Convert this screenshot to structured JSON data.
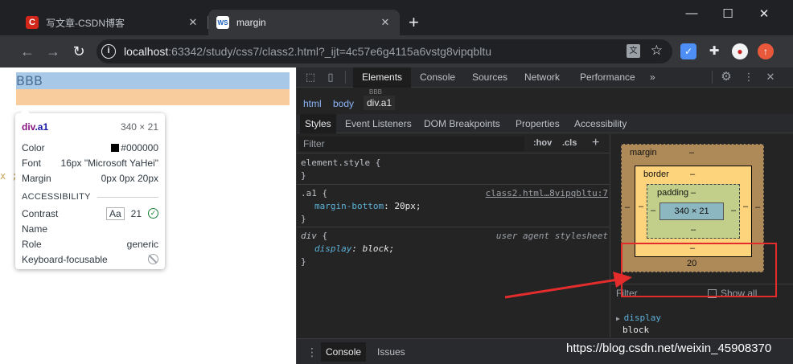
{
  "browser": {
    "tabs": [
      {
        "title": "写文章-CSDN博客",
        "favicon": "C",
        "active": false
      },
      {
        "title": "margin",
        "favicon": "WS",
        "active": true
      }
    ],
    "url_host": "localhost",
    "url_path": ":63342/study/css7/class2.html?_ijt=4c57e6g4115a6vstg8vipqbltu"
  },
  "page": {
    "element_text": "BBB",
    "gutter_text": "x ;"
  },
  "tooltip": {
    "tag": "div",
    "cls": ".a1",
    "size": "340 × 21",
    "rows": [
      {
        "label": "Color",
        "value": "#000000"
      },
      {
        "label": "Font",
        "value": "16px \"Microsoft YaHei\""
      },
      {
        "label": "Margin",
        "value": "0px 0px 20px"
      }
    ],
    "section": "ACCESSIBILITY",
    "acc": [
      {
        "label": "Contrast",
        "aa": "Aa",
        "value": "21"
      },
      {
        "label": "Name",
        "value": ""
      },
      {
        "label": "Role",
        "value": "generic"
      },
      {
        "label": "Keyboard-focusable",
        "value": ""
      }
    ]
  },
  "devtools": {
    "tabs": [
      "Elements",
      "Console",
      "Sources",
      "Network",
      "Performance",
      "»"
    ],
    "breadcrumb_faded": "BBB",
    "breadcrumbs": [
      "html",
      "body",
      "div.a1"
    ],
    "sub_tabs": [
      "Styles",
      "Event Listeners",
      "DOM Breakpoints",
      "Properties",
      "Accessibility"
    ],
    "filter_placeholder": "Filter",
    "hov": ":hov",
    "cls": ".cls",
    "plus": "+",
    "rules": {
      "element": {
        "selector": "element.style {",
        "close": "}"
      },
      "a1": {
        "selector": ".a1",
        "open": " {",
        "source": "class2.html…8vipqbltu:7",
        "prop": "margin-bottom",
        "value": "20px;",
        "close": "}"
      },
      "div": {
        "selector": "div",
        "open": " {",
        "source": "user agent stylesheet",
        "prop": "display",
        "value": "block;",
        "close": "}"
      }
    },
    "boxmodel": {
      "margin_label": "margin",
      "border_label": "border",
      "padding_label": "padding",
      "content": "340 × 21",
      "dash": "–",
      "margin_bottom": "20"
    },
    "boxpane_filter": "Filter",
    "show_all": "Show all",
    "computed": {
      "prop": "display",
      "value": "block"
    },
    "drawer_tabs": [
      "Console",
      "Issues"
    ]
  },
  "watermark": "https://blog.csdn.net/weixin_45908370",
  "colors": {
    "annotation": "#e52c2c",
    "accent_link": "#8ab4f8"
  }
}
